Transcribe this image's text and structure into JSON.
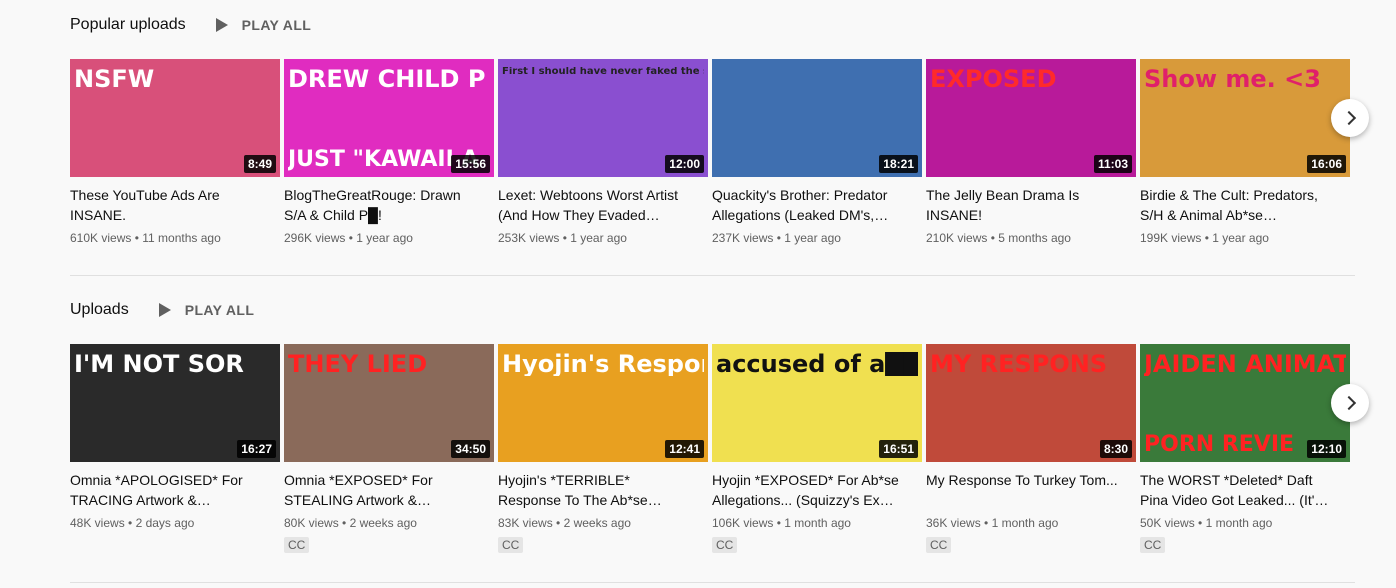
{
  "popular": {
    "title": "Popular uploads",
    "play_all": "PLAY ALL",
    "videos": [
      {
        "title": "These YouTube Ads Are INSANE.",
        "views": "610K views",
        "age": "11 months ago",
        "duration": "8:49",
        "thumb_text": "NSFW",
        "bg": "#d8507a",
        "fg": "#ffffff"
      },
      {
        "title": "BlogTheGreatRouge: Drawn S/A & Child P█!",
        "views": "296K views",
        "age": "1 year ago",
        "duration": "15:56",
        "thumb_text": "DREW CHILD P",
        "thumb_text2": "JUST \"KAWAII A",
        "bg": "#e02cc0",
        "fg": "#ffffff"
      },
      {
        "title": "Lexet: Webtoons Worst Artist (And How They Evaded…",
        "views": "253K views",
        "age": "1 year ago",
        "duration": "12:00",
        "thumb_text": "First I should have never faked the screenshot.",
        "bg": "#8a4fd0",
        "fg": "#222222"
      },
      {
        "title": "Quackity's Brother: Predator Allegations (Leaked DM's,…",
        "views": "237K views",
        "age": "1 year ago",
        "duration": "18:21",
        "thumb_text": "",
        "bg": "#3f6fb0",
        "fg": "#ffffff"
      },
      {
        "title": "The Jelly Bean Drama Is INSANE!",
        "views": "210K views",
        "age": "5 months ago",
        "duration": "11:03",
        "thumb_text": "EXPOSED",
        "bg": "#b81a9a",
        "fg": "#ff2a2a"
      },
      {
        "title": "Birdie & The Cult: Predators, S/H & Animal Ab*se…",
        "views": "199K views",
        "age": "1 year ago",
        "duration": "16:06",
        "thumb_text": "Show me. <3",
        "bg": "#d89a3a",
        "fg": "#e0206a"
      }
    ]
  },
  "uploads": {
    "title": "Uploads",
    "play_all": "PLAY ALL",
    "videos": [
      {
        "title": "Omnia *APOLOGISED* For TRACING Artwork &…",
        "views": "48K views",
        "age": "2 days ago",
        "duration": "16:27",
        "thumb_text": "I'M NOT SOR",
        "bg": "#2a2a2a",
        "fg": "#ffffff",
        "cc": ""
      },
      {
        "title": "Omnia *EXPOSED* For STEALING Artwork &…",
        "views": "80K views",
        "age": "2 weeks ago",
        "duration": "34:50",
        "thumb_text": "THEY LIED",
        "bg": "#8a6a5a",
        "fg": "#ff2222",
        "cc": "CC"
      },
      {
        "title": "Hyojin's *TERRIBLE* Response To The Ab*se…",
        "views": "83K views",
        "age": "2 weeks ago",
        "duration": "12:41",
        "thumb_text": "Hyojin's Respon",
        "bg": "#e8a020",
        "fg": "#ffffff",
        "cc": "CC"
      },
      {
        "title": "Hyojin *EXPOSED* For Ab*se Allegations... (Squizzy's Ex…",
        "views": "106K views",
        "age": "1 month ago",
        "duration": "16:51",
        "thumb_text": "accused of a████ult",
        "bg": "#f0e050",
        "fg": "#111111",
        "cc": "CC"
      },
      {
        "title": "My Response To Turkey Tom...",
        "views": "36K views",
        "age": "1 month ago",
        "duration": "8:30",
        "thumb_text": "MY RESPONS",
        "bg": "#c04a3a",
        "fg": "#ff2222",
        "cc": "CC"
      },
      {
        "title": "The WORST *Deleted* Daft Pina Video Got Leaked... (It'…",
        "views": "50K views",
        "age": "1 month ago",
        "duration": "12:10",
        "thumb_text": "JAIDEN ANIMATIONS",
        "thumb_text2": "PORN REVIE",
        "bg": "#3a7a3a",
        "fg": "#ff2222",
        "cc": "CC"
      }
    ]
  }
}
